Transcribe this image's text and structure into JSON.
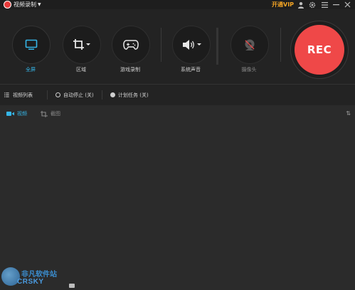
{
  "titlebar": {
    "mode": "视频录制",
    "vip": "开通VIP",
    "icons": [
      "user-icon",
      "gear-icon",
      "menu-icon",
      "minimize-icon",
      "close-icon"
    ]
  },
  "tools": {
    "fullscreen": "全屏",
    "region": "区域",
    "game": "游戏录制",
    "system_audio": "系统声音",
    "camera": "摄像头"
  },
  "rec_label": "REC",
  "options": {
    "video_list": "视频列表",
    "auto_stop": "自动停止 (关)",
    "schedule": "计划任务 (关)"
  },
  "tabs": {
    "video": "视频",
    "screenshot": "截图"
  },
  "watermark": {
    "line1": "非凡软件站",
    "line2": "CRSKY"
  },
  "colors": {
    "accent": "#35b6e8",
    "rec": "#ef4848",
    "vip": "#f5a524"
  }
}
